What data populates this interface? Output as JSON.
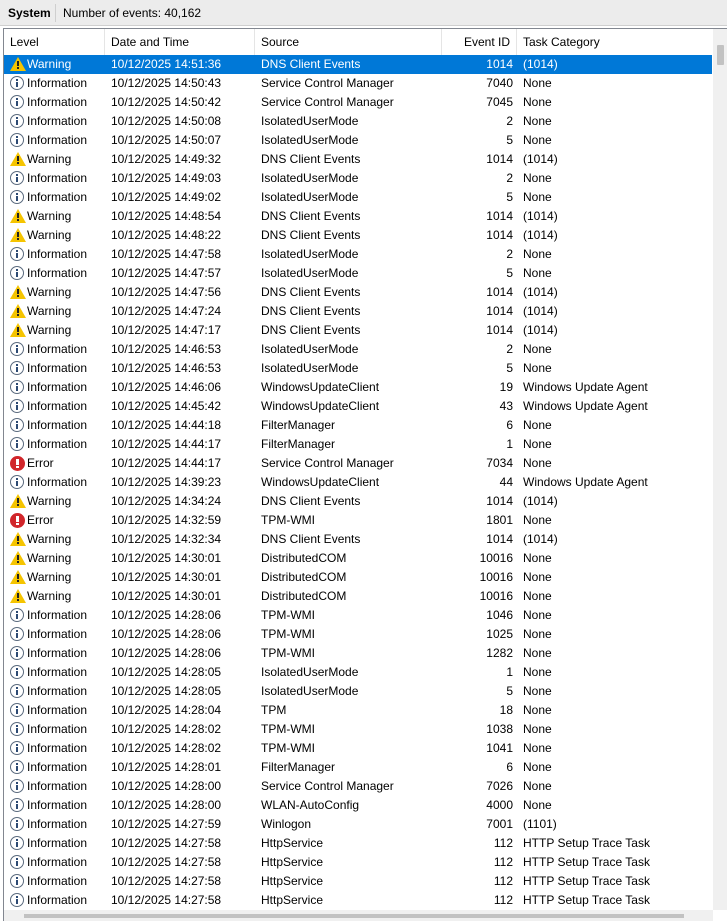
{
  "title": {
    "name": "System",
    "count_text": "Number of events: 40,162"
  },
  "columns": {
    "level": "Level",
    "date": "Date and Time",
    "source": "Source",
    "event_id": "Event ID",
    "task": "Task Category"
  },
  "icons": {
    "Information": "info-icon",
    "Warning": "warning-icon",
    "Error": "error-icon"
  },
  "colors": {
    "selection": "#0078d7",
    "warning": "#f5c400",
    "error": "#d1262b"
  },
  "rows": [
    {
      "level": "Warning",
      "date": "10/12/2025 14:51:36",
      "source": "DNS Client Events",
      "id": "1014",
      "task": "(1014)",
      "selected": true
    },
    {
      "level": "Information",
      "date": "10/12/2025 14:50:43",
      "source": "Service Control Manager",
      "id": "7040",
      "task": "None"
    },
    {
      "level": "Information",
      "date": "10/12/2025 14:50:42",
      "source": "Service Control Manager",
      "id": "7045",
      "task": "None"
    },
    {
      "level": "Information",
      "date": "10/12/2025 14:50:08",
      "source": "IsolatedUserMode",
      "id": "2",
      "task": "None"
    },
    {
      "level": "Information",
      "date": "10/12/2025 14:50:07",
      "source": "IsolatedUserMode",
      "id": "5",
      "task": "None"
    },
    {
      "level": "Warning",
      "date": "10/12/2025 14:49:32",
      "source": "DNS Client Events",
      "id": "1014",
      "task": "(1014)"
    },
    {
      "level": "Information",
      "date": "10/12/2025 14:49:03",
      "source": "IsolatedUserMode",
      "id": "2",
      "task": "None"
    },
    {
      "level": "Information",
      "date": "10/12/2025 14:49:02",
      "source": "IsolatedUserMode",
      "id": "5",
      "task": "None"
    },
    {
      "level": "Warning",
      "date": "10/12/2025 14:48:54",
      "source": "DNS Client Events",
      "id": "1014",
      "task": "(1014)"
    },
    {
      "level": "Warning",
      "date": "10/12/2025 14:48:22",
      "source": "DNS Client Events",
      "id": "1014",
      "task": "(1014)"
    },
    {
      "level": "Information",
      "date": "10/12/2025 14:47:58",
      "source": "IsolatedUserMode",
      "id": "2",
      "task": "None"
    },
    {
      "level": "Information",
      "date": "10/12/2025 14:47:57",
      "source": "IsolatedUserMode",
      "id": "5",
      "task": "None"
    },
    {
      "level": "Warning",
      "date": "10/12/2025 14:47:56",
      "source": "DNS Client Events",
      "id": "1014",
      "task": "(1014)"
    },
    {
      "level": "Warning",
      "date": "10/12/2025 14:47:24",
      "source": "DNS Client Events",
      "id": "1014",
      "task": "(1014)"
    },
    {
      "level": "Warning",
      "date": "10/12/2025 14:47:17",
      "source": "DNS Client Events",
      "id": "1014",
      "task": "(1014)"
    },
    {
      "level": "Information",
      "date": "10/12/2025 14:46:53",
      "source": "IsolatedUserMode",
      "id": "2",
      "task": "None"
    },
    {
      "level": "Information",
      "date": "10/12/2025 14:46:53",
      "source": "IsolatedUserMode",
      "id": "5",
      "task": "None"
    },
    {
      "level": "Information",
      "date": "10/12/2025 14:46:06",
      "source": "WindowsUpdateClient",
      "id": "19",
      "task": "Windows Update Agent"
    },
    {
      "level": "Information",
      "date": "10/12/2025 14:45:42",
      "source": "WindowsUpdateClient",
      "id": "43",
      "task": "Windows Update Agent"
    },
    {
      "level": "Information",
      "date": "10/12/2025 14:44:18",
      "source": "FilterManager",
      "id": "6",
      "task": "None"
    },
    {
      "level": "Information",
      "date": "10/12/2025 14:44:17",
      "source": "FilterManager",
      "id": "1",
      "task": "None"
    },
    {
      "level": "Error",
      "date": "10/12/2025 14:44:17",
      "source": "Service Control Manager",
      "id": "7034",
      "task": "None"
    },
    {
      "level": "Information",
      "date": "10/12/2025 14:39:23",
      "source": "WindowsUpdateClient",
      "id": "44",
      "task": "Windows Update Agent"
    },
    {
      "level": "Warning",
      "date": "10/12/2025 14:34:24",
      "source": "DNS Client Events",
      "id": "1014",
      "task": "(1014)"
    },
    {
      "level": "Error",
      "date": "10/12/2025 14:32:59",
      "source": "TPM-WMI",
      "id": "1801",
      "task": "None"
    },
    {
      "level": "Warning",
      "date": "10/12/2025 14:32:34",
      "source": "DNS Client Events",
      "id": "1014",
      "task": "(1014)"
    },
    {
      "level": "Warning",
      "date": "10/12/2025 14:30:01",
      "source": "DistributedCOM",
      "id": "10016",
      "task": "None"
    },
    {
      "level": "Warning",
      "date": "10/12/2025 14:30:01",
      "source": "DistributedCOM",
      "id": "10016",
      "task": "None"
    },
    {
      "level": "Warning",
      "date": "10/12/2025 14:30:01",
      "source": "DistributedCOM",
      "id": "10016",
      "task": "None"
    },
    {
      "level": "Information",
      "date": "10/12/2025 14:28:06",
      "source": "TPM-WMI",
      "id": "1046",
      "task": "None"
    },
    {
      "level": "Information",
      "date": "10/12/2025 14:28:06",
      "source": "TPM-WMI",
      "id": "1025",
      "task": "None"
    },
    {
      "level": "Information",
      "date": "10/12/2025 14:28:06",
      "source": "TPM-WMI",
      "id": "1282",
      "task": "None"
    },
    {
      "level": "Information",
      "date": "10/12/2025 14:28:05",
      "source": "IsolatedUserMode",
      "id": "1",
      "task": "None"
    },
    {
      "level": "Information",
      "date": "10/12/2025 14:28:05",
      "source": "IsolatedUserMode",
      "id": "5",
      "task": "None"
    },
    {
      "level": "Information",
      "date": "10/12/2025 14:28:04",
      "source": "TPM",
      "id": "18",
      "task": "None"
    },
    {
      "level": "Information",
      "date": "10/12/2025 14:28:02",
      "source": "TPM-WMI",
      "id": "1038",
      "task": "None"
    },
    {
      "level": "Information",
      "date": "10/12/2025 14:28:02",
      "source": "TPM-WMI",
      "id": "1041",
      "task": "None"
    },
    {
      "level": "Information",
      "date": "10/12/2025 14:28:01",
      "source": "FilterManager",
      "id": "6",
      "task": "None"
    },
    {
      "level": "Information",
      "date": "10/12/2025 14:28:00",
      "source": "Service Control Manager",
      "id": "7026",
      "task": "None"
    },
    {
      "level": "Information",
      "date": "10/12/2025 14:28:00",
      "source": "WLAN-AutoConfig",
      "id": "4000",
      "task": "None"
    },
    {
      "level": "Information",
      "date": "10/12/2025 14:27:59",
      "source": "Winlogon",
      "id": "7001",
      "task": "(1101)"
    },
    {
      "level": "Information",
      "date": "10/12/2025 14:27:58",
      "source": "HttpService",
      "id": "112",
      "task": "HTTP Setup Trace Task"
    },
    {
      "level": "Information",
      "date": "10/12/2025 14:27:58",
      "source": "HttpService",
      "id": "112",
      "task": "HTTP Setup Trace Task"
    },
    {
      "level": "Information",
      "date": "10/12/2025 14:27:58",
      "source": "HttpService",
      "id": "112",
      "task": "HTTP Setup Trace Task"
    },
    {
      "level": "Information",
      "date": "10/12/2025 14:27:58",
      "source": "HttpService",
      "id": "112",
      "task": "HTTP Setup Trace Task"
    }
  ]
}
